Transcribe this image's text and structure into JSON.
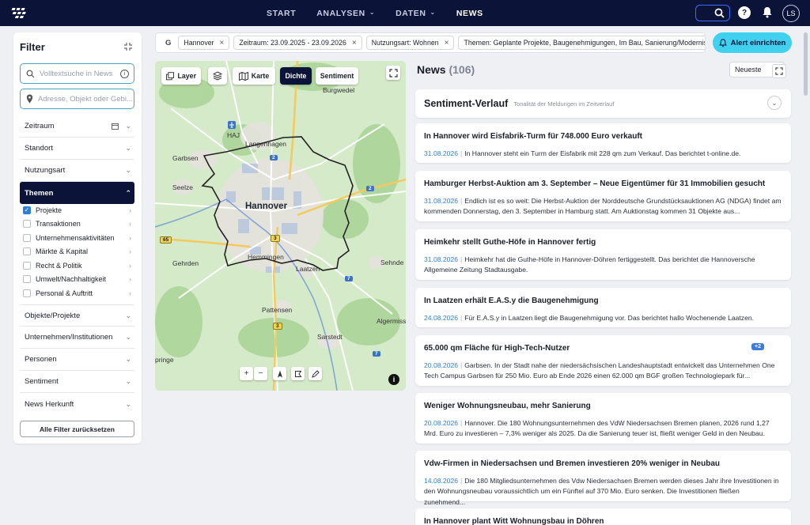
{
  "nav": {
    "items": [
      {
        "label": "START",
        "dropdown": false,
        "active": false
      },
      {
        "label": "ANALYSEN",
        "dropdown": true,
        "active": false
      },
      {
        "label": "DATEN",
        "dropdown": true,
        "active": false
      },
      {
        "label": "NEWS",
        "dropdown": false,
        "active": true
      }
    ],
    "user_initials": "LS",
    "help_label": "?"
  },
  "filter": {
    "title": "Filter",
    "search_placeholder": "Volltextsuche in News",
    "address_placeholder": "Adresse, Objekt oder Gebi...",
    "sections": {
      "zeitraum": "Zeitraum",
      "standort": "Standort",
      "nutzungsart": "Nutzungsart",
      "themen": "Themen",
      "objekte": "Objekte/Projekte",
      "unternehmen": "Unternehmen/Institutionen",
      "personen": "Personen",
      "sentiment": "Sentiment",
      "herkunft": "News Herkunft"
    },
    "themen_items": [
      {
        "label": "Projekte",
        "checked": true
      },
      {
        "label": "Transaktionen",
        "checked": false
      },
      {
        "label": "Unternehmensaktivitäten",
        "checked": false
      },
      {
        "label": "Märkte & Kapital",
        "checked": false
      },
      {
        "label": "Recht & Politik",
        "checked": false
      },
      {
        "label": "Umwelt/Nachhaltigkeit",
        "checked": false
      },
      {
        "label": "Personal & Auftritt",
        "checked": false
      }
    ],
    "reset_label": "Alle Filter zurücksetzen"
  },
  "chips": {
    "group_label": "G",
    "items": [
      "Hannover",
      "Zeitraum: 23.09.2025 - 23.09.2026",
      "Nutzungsart: Wohnen",
      "Themen: Geplante Projekte, Baugenehmigungen, Im Bau, Sanierung/Modernisie"
    ]
  },
  "alert_button": "Alert einrichten",
  "map": {
    "buttons": {
      "layer": "Layer",
      "karte": "Karte",
      "dichte": "Dichte",
      "sentiment": "Sentiment"
    },
    "city": "Hannover",
    "places": {
      "burgwedel": "Burgwedel",
      "haj": "HAJ",
      "langenhagen": "Langenhagen",
      "garbsen": "Garbsen",
      "seelze": "Seelze",
      "gehrden": "Gehrden",
      "hemmingen": "Hemmingen",
      "laatzen": "Laatzen",
      "sehnde": "Sehnde",
      "pattensen": "Pattensen",
      "algermissen": "Algermiss",
      "sarstedt": "Sarstedt",
      "springe": "pringe"
    },
    "roads": {
      "a2_top": "2",
      "a2_right": "2",
      "a7_mid": "7",
      "a7_low": "7",
      "b3_mid": "3",
      "b3_low": "3",
      "b65": "65"
    }
  },
  "news": {
    "title": "News",
    "count": "(106)",
    "sort_label": "Neueste",
    "sentiment_title": "Sentiment-Verlauf",
    "sentiment_subtitle": "Tonalität der Meldungen im Zeitverlauf",
    "items": [
      {
        "title": "In Hannover wird Eisfabrik-Turm für 748.000 Euro verkauft",
        "date": "31.08.2026",
        "text": "In Hannover steht ein Turm der Eisfabrik mit 228 qm zum Verkauf. Das berichtet t-online.de.",
        "badge": ""
      },
      {
        "title": "Hamburger Herbst-Auktion am 3. September – Neue Eigentümer für 31 Immobilien gesucht",
        "date": "31.08.2026",
        "text": "Endlich ist es so weit: Die Herbst-Auktion der Norddeutsche Grundstücksauktionen AG (NDGA) findet am kommenden Donnerstag, den 3. September in Hamburg statt. Am Auktionstag kommen 31 Objekte aus...",
        "badge": ""
      },
      {
        "title": "Heimkehr stellt Guthe-Höfe in Hannover fertig",
        "date": "31.08.2026",
        "text": "Heimkehr hat die Guthe-Höfe in Hannover-Döhren fertiggestellt. Das berichtet die Hannoversche Allgemeine Zeitung Stadtausgabe.",
        "badge": ""
      },
      {
        "title": "In Laatzen erhält E.A.S.y die Baugenehmigung",
        "date": "24.08.2026",
        "text": "Für E.A.S.y in Laatzen liegt die Baugenehmigung vor. Das berichtet hallo Wochenende Laatzen.",
        "badge": ""
      },
      {
        "title": "65.000 qm Fläche für High-Tech-Nutzer",
        "date": "20.08.2026",
        "text": "Garbsen. In der Stadt nahe der niedersächsischen Landeshauptstadt entwickelt das Unternehmen One Tech Campus Garbsen für 250 Mio. Euro ab Ende 2026 einen 62.000 qm BGF großen Technologiepark für...",
        "badge": "+2"
      },
      {
        "title": "Weniger Wohnungsneubau, mehr Sanierung",
        "date": "20.08.2026",
        "text": "Hannover. Die 180 Wohnungsunternehmen des VdW Niedersachsen Bremen planen, 2026 rund 1,27 Mrd. Euro zu investieren – 7,3% weniger als 2025. Da die Sanierung teuer ist, fließt weniger Geld in den Neubau.",
        "badge": ""
      },
      {
        "title": "Vdw-Firmen in Niedersachsen und Bremen investieren 20% weniger in Neubau",
        "date": "14.08.2026",
        "text": "Die 180 Mitgliedsunternehmen des Vdw Niedersachsen Bremen werden dieses Jahr ihre Investitionen in den Wohnungsneubau voraussichtlich um ein Fünftel auf 370 Mio. Euro senken. Die Investitionen fließen zunehmend...",
        "badge": ""
      },
      {
        "title": "In Hannover plant Witt Wohnungsbau in Döhren",
        "date": "",
        "text": "",
        "badge": ""
      }
    ]
  }
}
